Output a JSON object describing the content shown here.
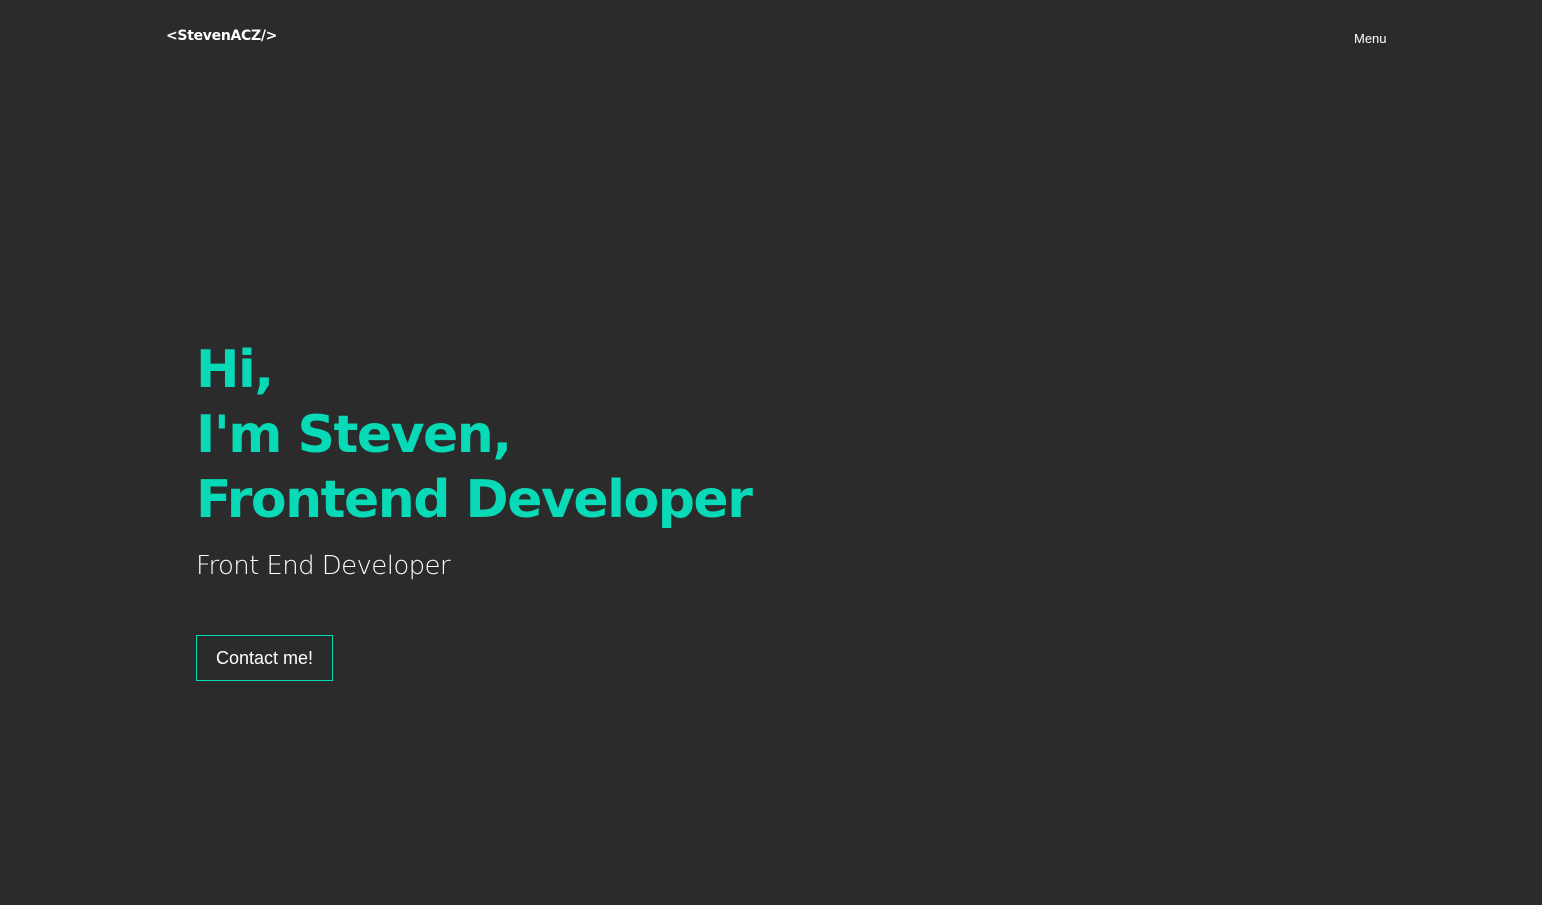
{
  "header": {
    "logo_text": "<StevenACZ/>",
    "menu_label": "Menu"
  },
  "hero": {
    "headline_lines": [
      "Hi,",
      "I'm Steven,",
      "Frontend Developer"
    ],
    "subtitle": "Front End Developer",
    "cta_label": "Contact me!"
  },
  "colors": {
    "background": "#2b2b2b",
    "accent": "#08d9b6",
    "text": "#ffffff",
    "blob_red": "#f01414",
    "blob_cyan": "#00f0f0",
    "blob_yellow": "#ffd84a",
    "blob_magenta": "#dc00e6"
  }
}
